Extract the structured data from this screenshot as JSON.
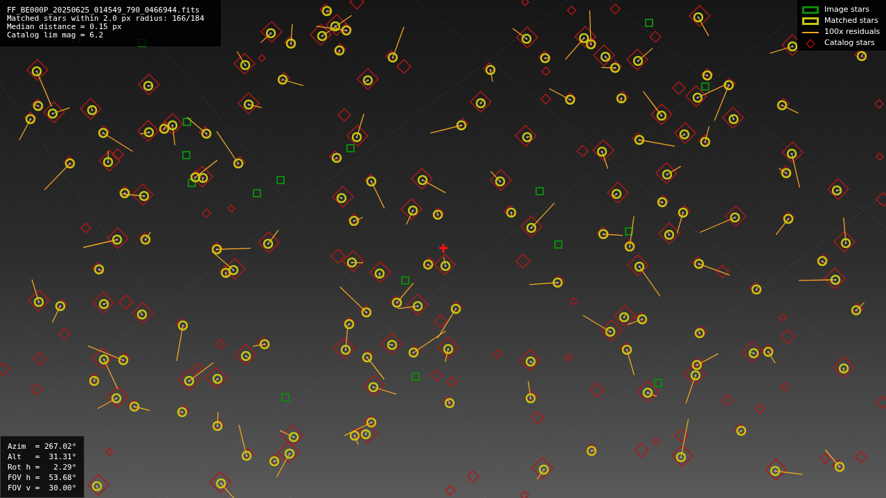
{
  "info": {
    "filename": "FF_BE000P_20250625_014549_790_0466944.fits",
    "lines": [
      "Matched stars within 2.0 px radius: 166/184",
      "Median distance = 0.15 px",
      "Catalog lim mag = 6.2"
    ]
  },
  "legend": [
    {
      "kind": "box",
      "label": "Image stars",
      "color": "#0b8a0b"
    },
    {
      "kind": "box",
      "label": "Matched stars",
      "color": "#c8c814"
    },
    {
      "kind": "line",
      "label": "100x residuals",
      "color": "#f5a623"
    },
    {
      "kind": "diamond",
      "label": "Catalog stars",
      "color": "#a01010"
    }
  ],
  "readout": [
    "Azim  = 267.02°",
    "Alt   =  31.31°",
    "Rot h =   2.29°",
    "FOV h =  53.68°",
    "FOV v =  30.00°"
  ]
}
